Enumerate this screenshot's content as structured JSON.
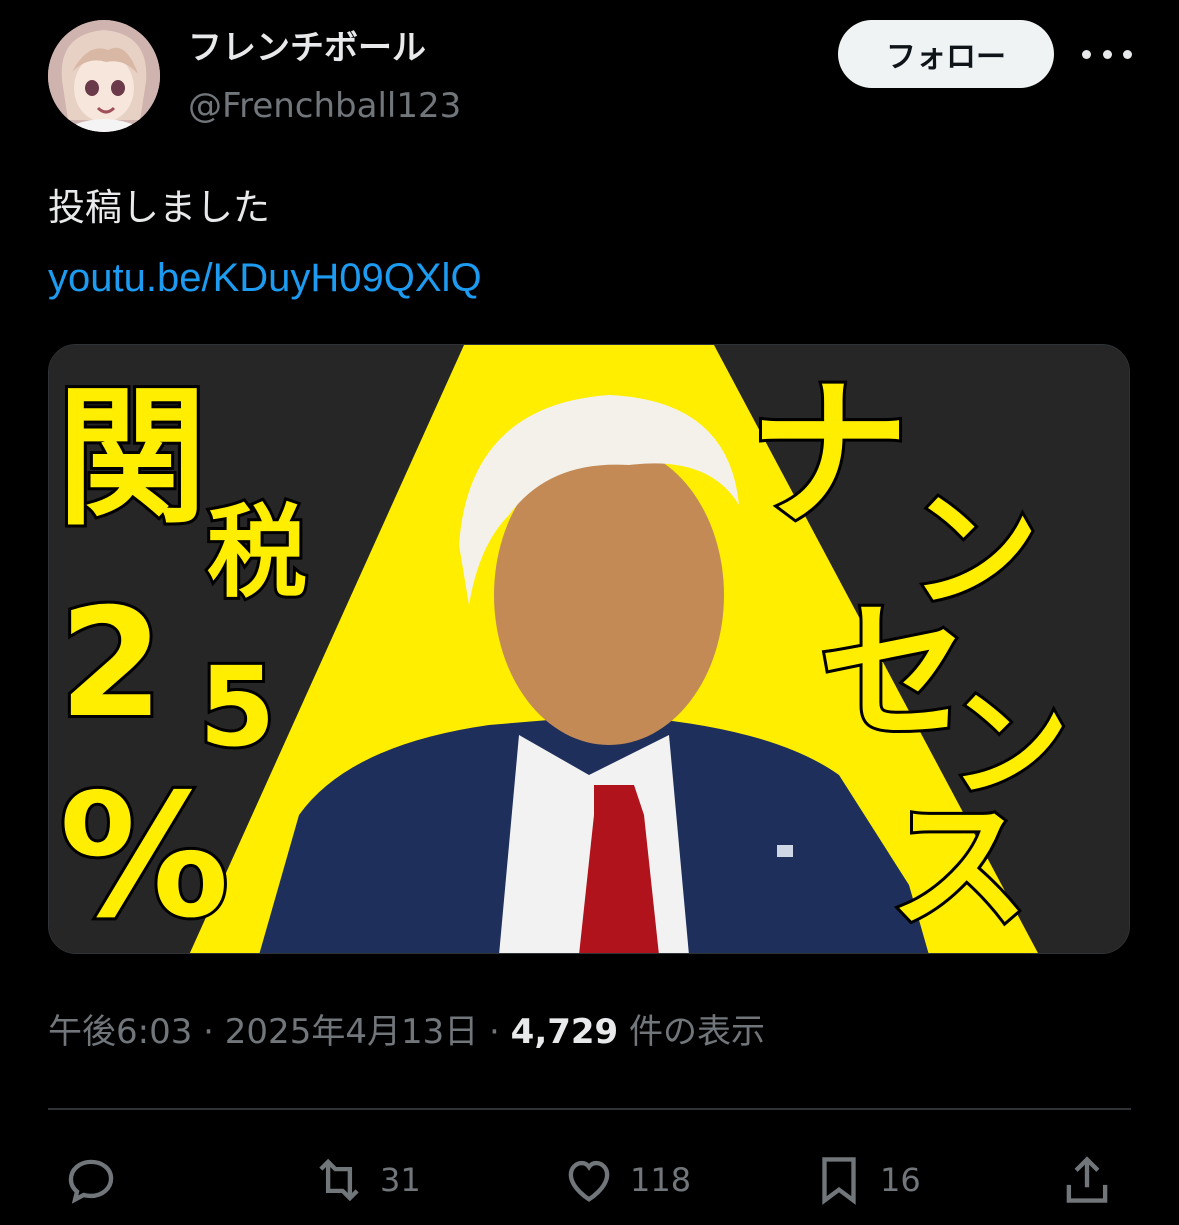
{
  "author": {
    "display_name": "フレンチボール",
    "handle": "@Frenchball123",
    "avatar_icon": "anime-girl-avatar"
  },
  "follow_label": "フォロー",
  "more_icon": "more-horizontal-icon",
  "tweet": {
    "text": "投稿しました",
    "link": "youtu.be/KDuyH09QXlQ"
  },
  "media": {
    "left_text_1": "関",
    "left_text_2": "税",
    "left_text_3": "2",
    "left_text_4": "5",
    "left_text_5": "%",
    "right_text_1": "ナ",
    "right_text_2": "ン",
    "right_text_3": "セ",
    "right_text_4": "ン",
    "right_text_5": "ス",
    "colors": {
      "background": "#262626",
      "accent": "#ffee00",
      "suit": "#1e2f5c",
      "tie": "#b0131c"
    }
  },
  "meta": {
    "time": "午後6:03",
    "date": "2025年4月13日",
    "views_count": "4,729",
    "views_label": "件の表示"
  },
  "actions": {
    "reply_icon": "reply-icon",
    "retweet_icon": "retweet-icon",
    "retweet_count": "31",
    "like_icon": "heart-icon",
    "like_count": "118",
    "bookmark_icon": "bookmark-icon",
    "bookmark_count": "16",
    "share_icon": "share-icon"
  },
  "colors": {
    "link": "#1d9bf0",
    "secondary": "#71767b",
    "primary": "#e7e9ea"
  }
}
